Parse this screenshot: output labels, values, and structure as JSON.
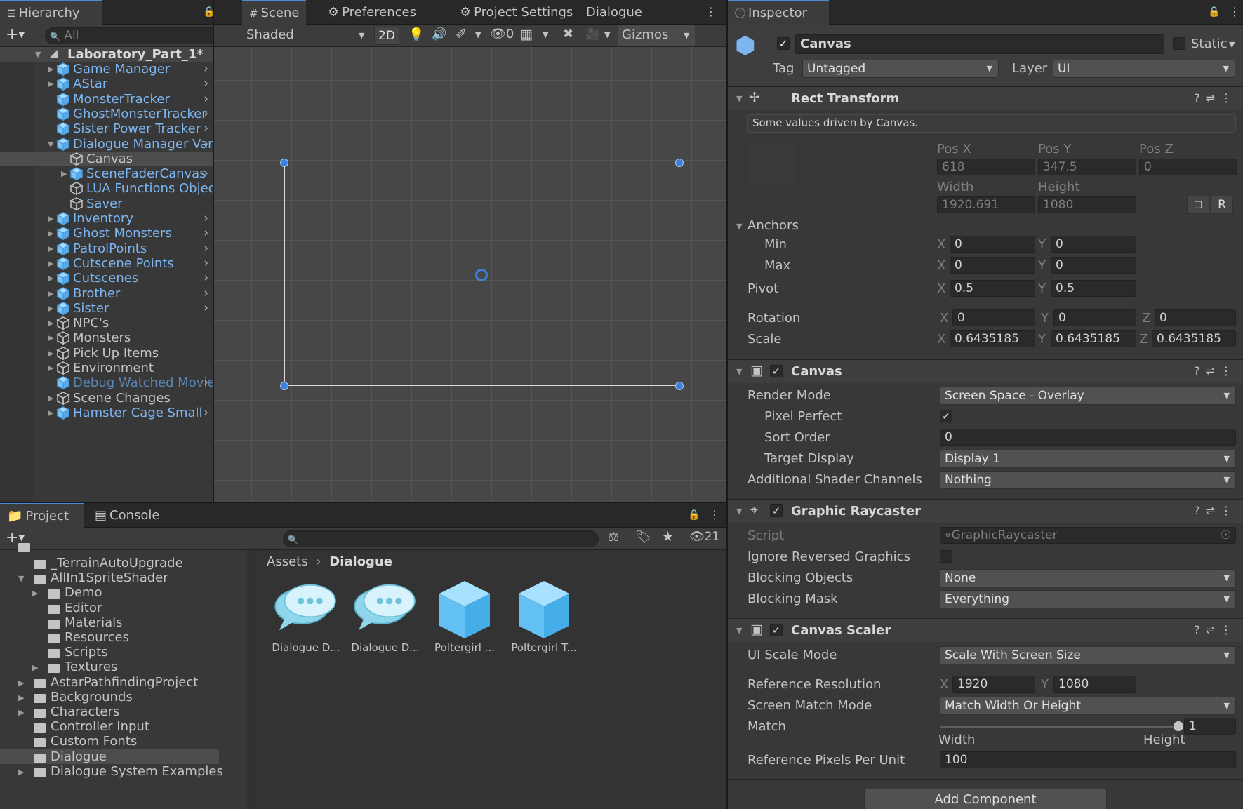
{
  "hierarchy": {
    "tab": "Hierarchy",
    "search_placeholder": "All",
    "scene": "Laboratory_Part_1*",
    "items": [
      {
        "label": "Game Manager",
        "type": "prefab",
        "chevron": true,
        "expand": "closed"
      },
      {
        "label": "AStar",
        "type": "prefab",
        "chevron": true,
        "expand": "closed"
      },
      {
        "label": "MonsterTracker",
        "type": "prefab",
        "chevron": true,
        "expand": "none"
      },
      {
        "label": "GhostMonsterTracker",
        "type": "prefab",
        "chevron": true,
        "expand": "none"
      },
      {
        "label": "Sister Power Tracker",
        "type": "prefab",
        "chevron": true,
        "expand": "none"
      },
      {
        "label": "Dialogue Manager Vari",
        "type": "prefab",
        "chevron": true,
        "expand": "open"
      },
      {
        "label": "Canvas",
        "type": "object",
        "indent": 1,
        "selected": true
      },
      {
        "label": "SceneFaderCanvas",
        "type": "prefab",
        "indent": 1,
        "chevron": true,
        "expand": "closed"
      },
      {
        "label": "LUA Functions Object",
        "type": "object",
        "indent": 1,
        "blue": true
      },
      {
        "label": "Saver",
        "type": "object",
        "indent": 1,
        "blue": true
      },
      {
        "label": "Inventory",
        "type": "prefab",
        "chevron": true,
        "expand": "closed"
      },
      {
        "label": "Ghost Monsters",
        "type": "prefab",
        "chevron": true,
        "expand": "closed"
      },
      {
        "label": "PatrolPoints",
        "type": "prefab",
        "chevron": true,
        "expand": "closed"
      },
      {
        "label": "Cutscene Points",
        "type": "prefab",
        "chevron": true,
        "expand": "closed"
      },
      {
        "label": "Cutscenes",
        "type": "prefab",
        "chevron": true,
        "expand": "closed"
      },
      {
        "label": "Brother",
        "type": "prefab",
        "chevron": true,
        "expand": "closed"
      },
      {
        "label": "Sister",
        "type": "prefab",
        "chevron": true,
        "expand": "closed"
      },
      {
        "label": "NPC's",
        "type": "object",
        "expand": "closed"
      },
      {
        "label": "Monsters",
        "type": "object",
        "expand": "closed"
      },
      {
        "label": "Pick Up Items",
        "type": "object",
        "expand": "closed"
      },
      {
        "label": "Environment",
        "type": "object",
        "expand": "closed"
      },
      {
        "label": "Debug Watched Movie",
        "type": "prefab",
        "chevron": true,
        "expand": "none",
        "faded": true
      },
      {
        "label": "Scene Changes",
        "type": "object",
        "expand": "closed"
      },
      {
        "label": "Hamster Cage Small",
        "type": "prefab",
        "chevron": true,
        "expand": "closed"
      }
    ]
  },
  "scene_tabs": [
    "Scene",
    "Preferences",
    "Project Settings",
    "Dialogue"
  ],
  "scene_toolbar": {
    "shading": "Shaded",
    "mode_2d": "2D",
    "hidden_count": "0",
    "gizmos": "Gizmos"
  },
  "project": {
    "tabs": [
      "Project",
      "Console"
    ],
    "hidden_count": "21",
    "folders": [
      {
        "label": "_TerrainAutoUpgrade",
        "depth": 1,
        "expand": "none"
      },
      {
        "label": "AllIn1SpriteShader",
        "depth": 1,
        "expand": "open"
      },
      {
        "label": "Demo",
        "depth": 2,
        "expand": "closed"
      },
      {
        "label": "Editor",
        "depth": 2,
        "expand": "none"
      },
      {
        "label": "Materials",
        "depth": 2,
        "expand": "none"
      },
      {
        "label": "Resources",
        "depth": 2,
        "expand": "none"
      },
      {
        "label": "Scripts",
        "depth": 2,
        "expand": "none"
      },
      {
        "label": "Textures",
        "depth": 2,
        "expand": "closed"
      },
      {
        "label": "AstarPathfindingProject",
        "depth": 1,
        "expand": "closed"
      },
      {
        "label": "Backgrounds",
        "depth": 1,
        "expand": "closed"
      },
      {
        "label": "Characters",
        "depth": 1,
        "expand": "closed"
      },
      {
        "label": "Controller Input",
        "depth": 1,
        "expand": "none"
      },
      {
        "label": "Custom Fonts",
        "depth": 1,
        "expand": "none"
      },
      {
        "label": "Dialogue",
        "depth": 1,
        "expand": "none",
        "selected": true
      },
      {
        "label": "Dialogue System Examples",
        "depth": 1,
        "expand": "closed"
      }
    ],
    "breadcrumb": [
      "Assets",
      "Dialogue"
    ],
    "assets": [
      {
        "label": "Dialogue D...",
        "kind": "dialogue"
      },
      {
        "label": "Dialogue D...",
        "kind": "dialogue"
      },
      {
        "label": "Poltergirl ...",
        "kind": "cube"
      },
      {
        "label": "Poltergirl T...",
        "kind": "cube"
      }
    ]
  },
  "inspector": {
    "tab": "Inspector",
    "object_name": "Canvas",
    "static_label": "Static",
    "tag_label": "Tag",
    "tag_value": "Untagged",
    "layer_label": "Layer",
    "layer_value": "UI",
    "rect": {
      "title": "Rect Transform",
      "note": "Some values driven by Canvas.",
      "posx_label": "Pos X",
      "posy_label": "Pos Y",
      "posz_label": "Pos Z",
      "posx": "618",
      "posy": "347.5",
      "posz": "0",
      "width_label": "Width",
      "height_label": "Height",
      "width": "1920.691",
      "height": "1080",
      "anchors_label": "Anchors",
      "min_label": "Min",
      "max_label": "Max",
      "min_x": "0",
      "min_y": "0",
      "max_x": "0",
      "max_y": "0",
      "pivot_label": "Pivot",
      "pivot_x": "0.5",
      "pivot_y": "0.5",
      "rotation_label": "Rotation",
      "rot_x": "0",
      "rot_y": "0",
      "rot_z": "0",
      "scale_label": "Scale",
      "scale_x": "0.6435185",
      "scale_y": "0.6435185",
      "scale_z": "0.6435185",
      "axis_x": "X",
      "axis_y": "Y",
      "axis_z": "Z",
      "r_btn": "R"
    },
    "canvas": {
      "title": "Canvas",
      "render_mode_label": "Render Mode",
      "render_mode": "Screen Space - Overlay",
      "pixel_perfect_label": "Pixel Perfect",
      "sort_order_label": "Sort Order",
      "sort_order": "0",
      "target_display_label": "Target Display",
      "target_display": "Display 1",
      "shader_channels_label": "Additional Shader Channels",
      "shader_channels": "Nothing"
    },
    "raycaster": {
      "title": "Graphic Raycaster",
      "script_label": "Script",
      "script": "GraphicRaycaster",
      "ignore_label": "Ignore Reversed Graphics",
      "blocking_objects_label": "Blocking Objects",
      "blocking_objects": "None",
      "blocking_mask_label": "Blocking Mask",
      "blocking_mask": "Everything"
    },
    "scaler": {
      "title": "Canvas Scaler",
      "scale_mode_label": "UI Scale Mode",
      "scale_mode": "Scale With Screen Size",
      "ref_res_label": "Reference Resolution",
      "ref_x": "1920",
      "ref_y": "1080",
      "match_mode_label": "Screen Match Mode",
      "match_mode": "Match Width Or Height",
      "match_label": "Match",
      "match_value": "1",
      "match_fraction": 1,
      "match_left": "Width",
      "match_right": "Height",
      "ppu_label": "Reference Pixels Per Unit",
      "ppu": "100"
    },
    "add_component": "Add Component"
  }
}
